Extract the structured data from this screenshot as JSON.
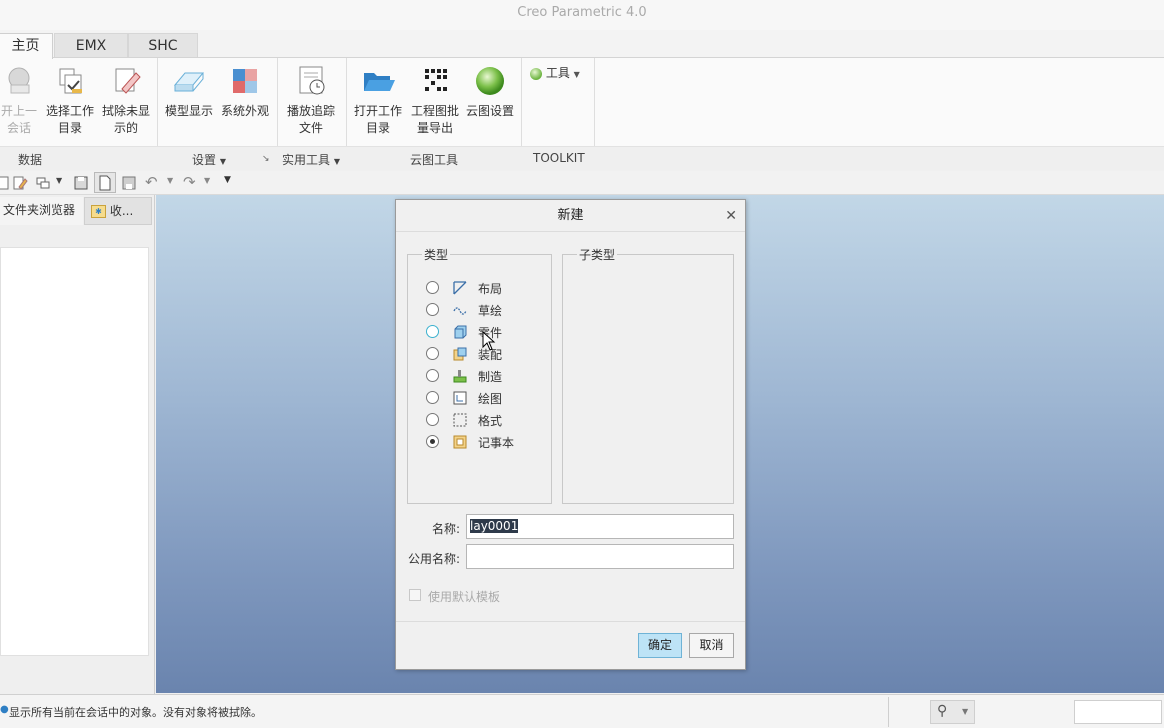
{
  "app": {
    "title": "Creo Parametric 4.0"
  },
  "tabs": [
    {
      "label": "主页"
    },
    {
      "label": "EMX"
    },
    {
      "label": "SHC"
    }
  ],
  "ribbon": {
    "buttons": [
      {
        "line1": "开上一",
        "line2": "会话",
        "icon": "open-session-icon"
      },
      {
        "line1": "选择工作",
        "line2": "目录",
        "icon": "select-working-dir-icon"
      },
      {
        "line1": "拭除未显",
        "line2": "示的",
        "icon": "erase-not-displayed-icon"
      },
      {
        "line1": "模型显示",
        "line2": "",
        "icon": "model-display-icon"
      },
      {
        "line1": "系统外观",
        "line2": "",
        "icon": "system-appearance-icon"
      },
      {
        "line1": "播放追踪",
        "line2": "文件",
        "icon": "play-trail-file-icon"
      },
      {
        "line1": "打开工作",
        "line2": "目录",
        "icon": "open-working-dir-icon"
      },
      {
        "line1": "工程图批",
        "line2": "量导出",
        "icon": "drawing-batch-export-icon"
      },
      {
        "line1": "云图设置",
        "line2": "",
        "icon": "cloud-settings-icon"
      }
    ],
    "tools_menu": "工具",
    "groups": [
      {
        "label": "数据"
      },
      {
        "label": "设置"
      },
      {
        "label": "实用工具"
      },
      {
        "label": "云图工具"
      },
      {
        "label": "TOOLKIT"
      }
    ]
  },
  "navigator": {
    "tabs": [
      {
        "label": "文件夹浏览器"
      },
      {
        "label": "收..."
      }
    ]
  },
  "dialog": {
    "title": "新建",
    "type_legend": "类型",
    "subtype_legend": "子类型",
    "types": [
      {
        "label": "布局",
        "icon": "layout-icon",
        "state": "unchecked"
      },
      {
        "label": "草绘",
        "icon": "sketch-icon",
        "state": "unchecked"
      },
      {
        "label": "零件",
        "icon": "part-icon",
        "state": "hover"
      },
      {
        "label": "装配",
        "icon": "assembly-icon",
        "state": "unchecked"
      },
      {
        "label": "制造",
        "icon": "manufacturing-icon",
        "state": "unchecked"
      },
      {
        "label": "绘图",
        "icon": "drawing-icon",
        "state": "unchecked"
      },
      {
        "label": "格式",
        "icon": "format-icon",
        "state": "unchecked"
      },
      {
        "label": "记事本",
        "icon": "notebook-icon",
        "state": "checked"
      }
    ],
    "name_label": "名称:",
    "name_value": "lay0001",
    "common_name_label": "公用名称:",
    "common_name_value": "",
    "use_default_template_label": "使用默认模板",
    "ok_label": "确定",
    "cancel_label": "取消"
  },
  "status": {
    "message": "显示所有当前在会话中的对象。没有对象将被拭除。"
  },
  "colors": {
    "accent": "#bde3f6",
    "graphics_top": "#c2d7e7",
    "graphics_bottom": "#6a84ae"
  }
}
